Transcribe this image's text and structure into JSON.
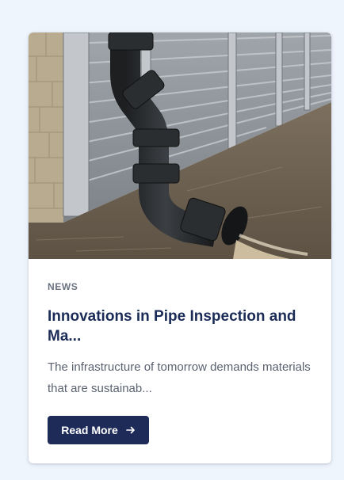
{
  "card": {
    "image_alt": "Black drainage pipe discharging water along a metal flood wall",
    "category": "NEWS",
    "title": "Innovations in Pipe Inspection and Ma...",
    "excerpt": "The infrastructure of tomorrow demands materials that are sustainab...",
    "button_label": "Read More",
    "button_icon": "arrow-right-icon"
  },
  "colors": {
    "page_background": "#eef5fc",
    "title": "#1b2b57",
    "button": "#1e2b59",
    "category": "#6b7280",
    "excerpt": "#5b6270"
  }
}
